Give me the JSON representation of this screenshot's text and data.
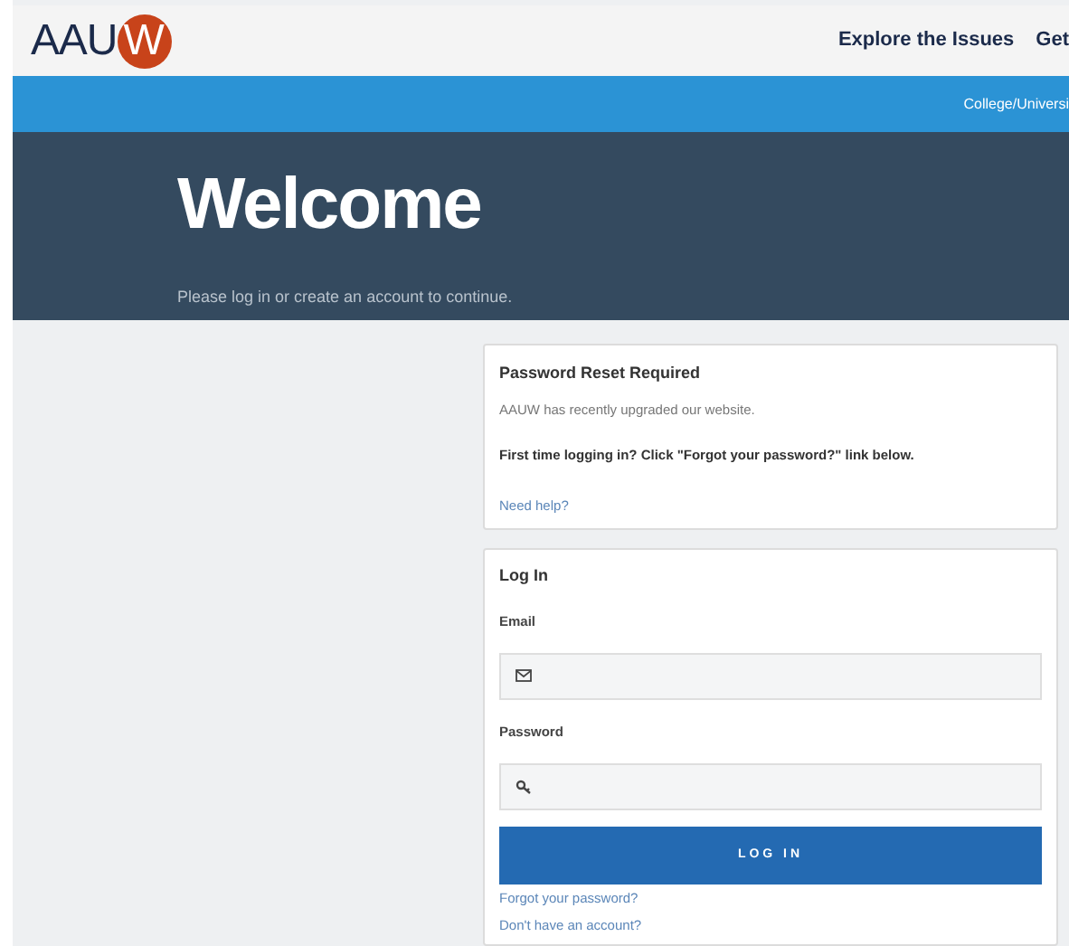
{
  "header": {
    "logo": {
      "text": "AAU",
      "mark": "W"
    },
    "nav": [
      "Explore the Issues",
      "Get"
    ]
  },
  "subnav": {
    "links": [
      "College/Universi"
    ]
  },
  "hero": {
    "title": "Welcome",
    "subtitle": "Please log in or create an account to continue."
  },
  "notice": {
    "title": "Password Reset Required",
    "text": "AAUW has recently upgraded our website.",
    "emphasis": "First time logging in? Click \"Forgot your password?\" link below.",
    "link": "Need help?"
  },
  "login": {
    "title": "Log In",
    "fields": [
      {
        "label": "Email",
        "kind": "email"
      },
      {
        "label": "Password",
        "kind": "password"
      }
    ],
    "button": "LOG IN",
    "links": [
      "Forgot your password?",
      "Don't have an account?"
    ]
  }
}
